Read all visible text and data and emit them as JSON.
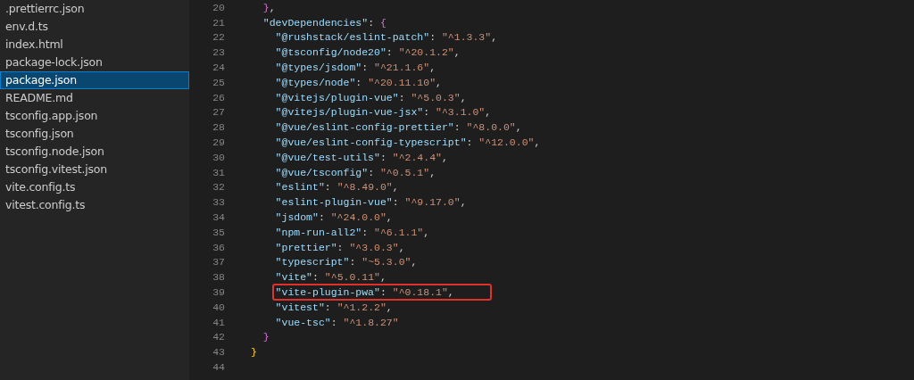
{
  "sidebar": {
    "files": [
      {
        "name": ".prettierrc.json",
        "selected": false
      },
      {
        "name": "env.d.ts",
        "selected": false
      },
      {
        "name": "index.html",
        "selected": false
      },
      {
        "name": "package-lock.json",
        "selected": false
      },
      {
        "name": "package.json",
        "selected": true
      },
      {
        "name": "README.md",
        "selected": false
      },
      {
        "name": "tsconfig.app.json",
        "selected": false
      },
      {
        "name": "tsconfig.json",
        "selected": false
      },
      {
        "name": "tsconfig.node.json",
        "selected": false
      },
      {
        "name": "tsconfig.vitest.json",
        "selected": false
      },
      {
        "name": "vite.config.ts",
        "selected": false
      },
      {
        "name": "vitest.config.ts",
        "selected": false
      }
    ]
  },
  "editor": {
    "body": [
      {
        "number": "20",
        "highlighted": false,
        "tokens": [
          {
            "kind": "brace2",
            "text": "}"
          },
          {
            "kind": "punct",
            "text": ","
          }
        ]
      },
      {
        "number": "21",
        "highlighted": false,
        "tokens": [
          {
            "kind": "key",
            "text": "\"devDependencies\""
          },
          {
            "kind": "punct",
            "text": ": "
          },
          {
            "kind": "brace2",
            "text": "{"
          }
        ],
        "children": [
          {
            "number": "22",
            "highlighted": false,
            "tokens": [
              {
                "kind": "key",
                "text": "\"@rushstack/eslint-patch\""
              },
              {
                "kind": "punct",
                "text": ": "
              },
              {
                "kind": "string",
                "text": "\"^1.3.3\""
              },
              {
                "kind": "punct",
                "text": ","
              }
            ]
          },
          {
            "number": "23",
            "highlighted": false,
            "tokens": [
              {
                "kind": "key",
                "text": "\"@tsconfig/node20\""
              },
              {
                "kind": "punct",
                "text": ": "
              },
              {
                "kind": "string",
                "text": "\"^20.1.2\""
              },
              {
                "kind": "punct",
                "text": ","
              }
            ]
          },
          {
            "number": "24",
            "highlighted": false,
            "tokens": [
              {
                "kind": "key",
                "text": "\"@types/jsdom\""
              },
              {
                "kind": "punct",
                "text": ": "
              },
              {
                "kind": "string",
                "text": "\"^21.1.6\""
              },
              {
                "kind": "punct",
                "text": ","
              }
            ]
          },
          {
            "number": "25",
            "highlighted": false,
            "tokens": [
              {
                "kind": "key",
                "text": "\"@types/node\""
              },
              {
                "kind": "punct",
                "text": ": "
              },
              {
                "kind": "string",
                "text": "\"^20.11.10\""
              },
              {
                "kind": "punct",
                "text": ","
              }
            ]
          },
          {
            "number": "26",
            "highlighted": false,
            "tokens": [
              {
                "kind": "key",
                "text": "\"@vitejs/plugin-vue\""
              },
              {
                "kind": "punct",
                "text": ": "
              },
              {
                "kind": "string",
                "text": "\"^5.0.3\""
              },
              {
                "kind": "punct",
                "text": ","
              }
            ]
          },
          {
            "number": "27",
            "highlighted": false,
            "tokens": [
              {
                "kind": "key",
                "text": "\"@vitejs/plugin-vue-jsx\""
              },
              {
                "kind": "punct",
                "text": ": "
              },
              {
                "kind": "string",
                "text": "\"^3.1.0\""
              },
              {
                "kind": "punct",
                "text": ","
              }
            ]
          },
          {
            "number": "28",
            "highlighted": false,
            "tokens": [
              {
                "kind": "key",
                "text": "\"@vue/eslint-config-prettier\""
              },
              {
                "kind": "punct",
                "text": ": "
              },
              {
                "kind": "string",
                "text": "\"^8.0.0\""
              },
              {
                "kind": "punct",
                "text": ","
              }
            ]
          },
          {
            "number": "29",
            "highlighted": false,
            "tokens": [
              {
                "kind": "key",
                "text": "\"@vue/eslint-config-typescript\""
              },
              {
                "kind": "punct",
                "text": ": "
              },
              {
                "kind": "string",
                "text": "\"^12.0.0\""
              },
              {
                "kind": "punct",
                "text": ","
              }
            ]
          },
          {
            "number": "30",
            "highlighted": false,
            "tokens": [
              {
                "kind": "key",
                "text": "\"@vue/test-utils\""
              },
              {
                "kind": "punct",
                "text": ": "
              },
              {
                "kind": "string",
                "text": "\"^2.4.4\""
              },
              {
                "kind": "punct",
                "text": ","
              }
            ]
          },
          {
            "number": "31",
            "highlighted": false,
            "tokens": [
              {
                "kind": "key",
                "text": "\"@vue/tsconfig\""
              },
              {
                "kind": "punct",
                "text": ": "
              },
              {
                "kind": "string",
                "text": "\"^0.5.1\""
              },
              {
                "kind": "punct",
                "text": ","
              }
            ]
          },
          {
            "number": "32",
            "highlighted": false,
            "tokens": [
              {
                "kind": "key",
                "text": "\"eslint\""
              },
              {
                "kind": "punct",
                "text": ": "
              },
              {
                "kind": "string",
                "text": "\"^8.49.0\""
              },
              {
                "kind": "punct",
                "text": ","
              }
            ]
          },
          {
            "number": "33",
            "highlighted": false,
            "tokens": [
              {
                "kind": "key",
                "text": "\"eslint-plugin-vue\""
              },
              {
                "kind": "punct",
                "text": ": "
              },
              {
                "kind": "string",
                "text": "\"^9.17.0\""
              },
              {
                "kind": "punct",
                "text": ","
              }
            ]
          },
          {
            "number": "34",
            "highlighted": false,
            "tokens": [
              {
                "kind": "key",
                "text": "\"jsdom\""
              },
              {
                "kind": "punct",
                "text": ": "
              },
              {
                "kind": "string",
                "text": "\"^24.0.0\""
              },
              {
                "kind": "punct",
                "text": ","
              }
            ]
          },
          {
            "number": "35",
            "highlighted": false,
            "tokens": [
              {
                "kind": "key",
                "text": "\"npm-run-all2\""
              },
              {
                "kind": "punct",
                "text": ": "
              },
              {
                "kind": "string",
                "text": "\"^6.1.1\""
              },
              {
                "kind": "punct",
                "text": ","
              }
            ]
          },
          {
            "number": "36",
            "highlighted": false,
            "tokens": [
              {
                "kind": "key",
                "text": "\"prettier\""
              },
              {
                "kind": "punct",
                "text": ": "
              },
              {
                "kind": "string",
                "text": "\"^3.0.3\""
              },
              {
                "kind": "punct",
                "text": ","
              }
            ]
          },
          {
            "number": "37",
            "highlighted": false,
            "tokens": [
              {
                "kind": "key",
                "text": "\"typescript\""
              },
              {
                "kind": "punct",
                "text": ": "
              },
              {
                "kind": "string",
                "text": "\"~5.3.0\""
              },
              {
                "kind": "punct",
                "text": ","
              }
            ]
          },
          {
            "number": "38",
            "highlighted": false,
            "tokens": [
              {
                "kind": "key",
                "text": "\"vite\""
              },
              {
                "kind": "punct",
                "text": ": "
              },
              {
                "kind": "string",
                "text": "\"^5.0.11\""
              },
              {
                "kind": "punct",
                "text": ","
              }
            ]
          },
          {
            "number": "39",
            "highlighted": true,
            "tokens": [
              {
                "kind": "key",
                "text": "\"vite-plugin-pwa\""
              },
              {
                "kind": "punct",
                "text": ": "
              },
              {
                "kind": "string",
                "text": "\"^0.18.1\""
              },
              {
                "kind": "punct",
                "text": ","
              }
            ]
          },
          {
            "number": "40",
            "highlighted": false,
            "tokens": [
              {
                "kind": "key",
                "text": "\"vitest\""
              },
              {
                "kind": "punct",
                "text": ": "
              },
              {
                "kind": "string",
                "text": "\"^1.2.2\""
              },
              {
                "kind": "punct",
                "text": ","
              }
            ]
          },
          {
            "number": "41",
            "highlighted": false,
            "tokens": [
              {
                "kind": "key",
                "text": "\"vue-tsc\""
              },
              {
                "kind": "punct",
                "text": ": "
              },
              {
                "kind": "string",
                "text": "\"^1.8.27\""
              }
            ]
          }
        ]
      },
      {
        "number": "42",
        "highlighted": false,
        "tokens": [
          {
            "kind": "brace2",
            "text": "}"
          }
        ]
      }
    ],
    "closing": [
      {
        "number": "43",
        "highlighted": false,
        "tokens": [
          {
            "kind": "brace1",
            "text": "}"
          }
        ]
      },
      {
        "number": "44"
      }
    ]
  }
}
